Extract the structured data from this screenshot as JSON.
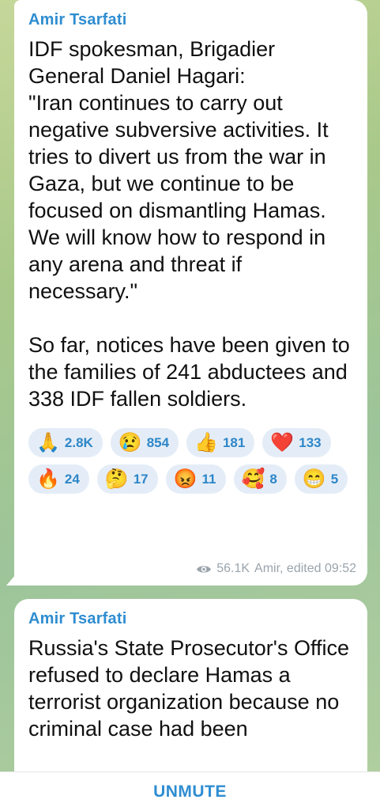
{
  "messages": [
    {
      "sender": "Amir Tsarfati",
      "text": "IDF spokesman, Brigadier General Daniel Hagari:\n\"Iran continues to carry out negative subversive activities. It tries to divert us from the war in Gaza, but we continue to be focused on dismantling Hamas. We will know how to respond in any arena and threat if necessary.\"\n\nSo far, notices have been given to the families of 241 abductees and 338 IDF fallen soldiers.",
      "reactions": [
        {
          "emoji": "🙏",
          "icon": "pray-icon",
          "count": "2.8K"
        },
        {
          "emoji": "😢",
          "icon": "crying-face-icon",
          "count": "854"
        },
        {
          "emoji": "👍",
          "icon": "thumbs-up-icon",
          "count": "181"
        },
        {
          "emoji": "❤️",
          "icon": "heart-icon",
          "count": "133"
        },
        {
          "emoji": "🔥",
          "icon": "fire-icon",
          "count": "24"
        },
        {
          "emoji": "🤔",
          "icon": "thinking-face-icon",
          "count": "17"
        },
        {
          "emoji": "😡",
          "icon": "angry-face-icon",
          "count": "11"
        },
        {
          "emoji": "🥰",
          "icon": "smiling-hearts-icon",
          "count": "8"
        },
        {
          "emoji": "😁",
          "icon": "grinning-face-icon",
          "count": "5"
        }
      ],
      "views": "56.1K",
      "author_time": "Amir, edited 09:52"
    },
    {
      "sender": "Amir Tsarfati",
      "text": "Russia's State Prosecutor's Office refused to declare Hamas a terrorist organization because no criminal case had been"
    }
  ],
  "footer": {
    "unmute_label": "UNMUTE"
  },
  "colors": {
    "accent": "#2e8dd1",
    "reaction_bg": "#e4edf7",
    "bubble": "#ffffff"
  }
}
